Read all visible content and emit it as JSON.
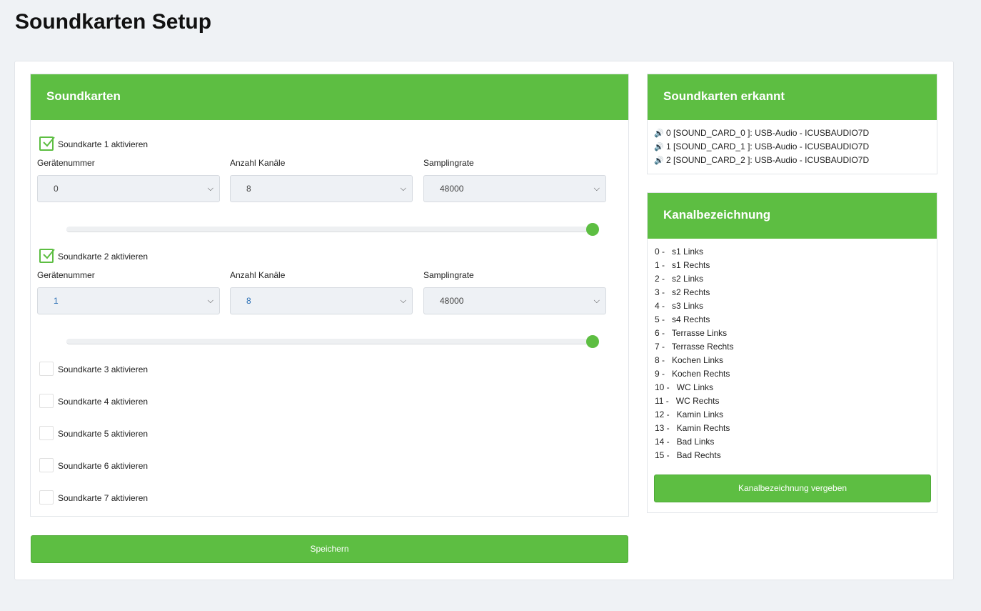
{
  "page_title": "Soundkarten Setup",
  "soundcards_panel": {
    "title": "Soundkarten",
    "cards": [
      {
        "label": "Soundkarte 1 aktivieren",
        "checked": true,
        "device_label": "Gerätenummer",
        "device_value": "0",
        "channels_label": "Anzahl Kanäle",
        "channels_value": "8",
        "rate_label": "Samplingrate",
        "rate_value": "48000",
        "slider_value": 1.0
      },
      {
        "label": "Soundkarte 2 aktivieren",
        "checked": true,
        "device_label": "Gerätenummer",
        "device_value": "1",
        "channels_label": "Anzahl Kanäle",
        "channels_value": "8",
        "rate_label": "Samplingrate",
        "rate_value": "48000",
        "slider_value": 1.0
      }
    ],
    "inactive": [
      "Soundkarte 3 aktivieren",
      "Soundkarte 4 aktivieren",
      "Soundkarte 5 aktivieren",
      "Soundkarte 6 aktivieren",
      "Soundkarte 7 aktivieren"
    ]
  },
  "save_button": "Speichern",
  "detected_panel": {
    "title": "Soundkarten erkannt",
    "items": [
      "0 [SOUND_CARD_0 ]: USB-Audio - ICUSBAUDIO7D",
      "1 [SOUND_CARD_1 ]: USB-Audio - ICUSBAUDIO7D",
      "2 [SOUND_CARD_2 ]: USB-Audio - ICUSBAUDIO7D"
    ]
  },
  "channel_panel": {
    "title": "Kanalbezeichnung",
    "items": [
      "0 -   s1 Links",
      "1 -   s1 Rechts",
      "2 -   s2 Links",
      "3 -   s2 Rechts",
      "4 -   s3 Links",
      "5 -   s4 Rechts",
      "6 -   Terrasse Links",
      "7 -   Terrasse Rechts",
      "8 -   Kochen Links",
      "9 -   Kochen Rechts",
      "10 -   WC Links",
      "11 -   WC Rechts",
      "12 -   Kamin Links",
      "13 -   Kamin Rechts",
      "14 -   Bad Links",
      "15 -   Bad Rechts"
    ],
    "button": "Kanalbezeichnung vergeben"
  },
  "colors": {
    "accent": "#5dbe42"
  }
}
